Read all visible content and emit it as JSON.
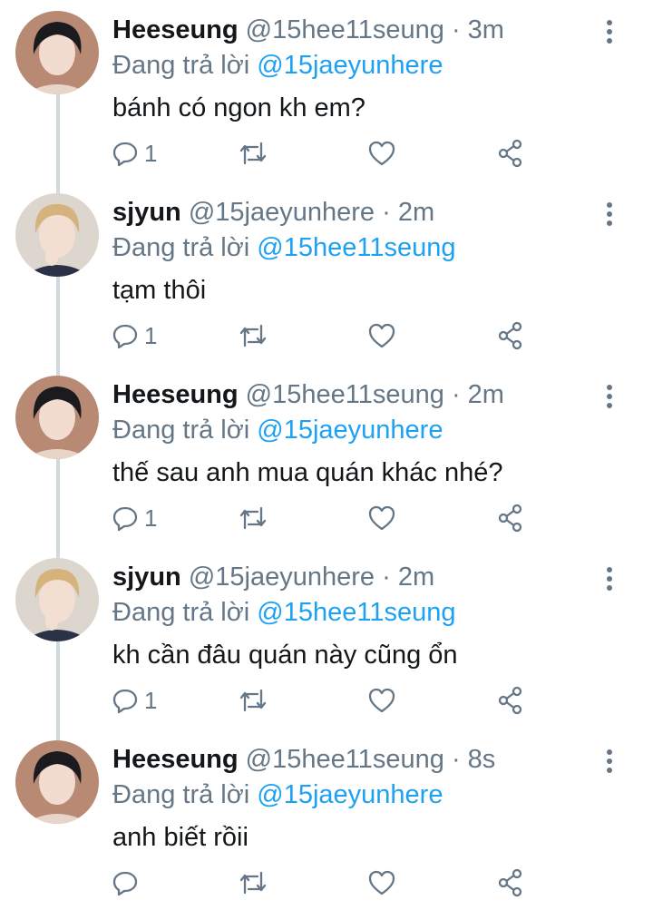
{
  "labels": {
    "replying_prefix": "Đang trả lời",
    "separator": "·"
  },
  "colors": {
    "link": "#1da1f2",
    "muted": "#657786",
    "text": "#14171a",
    "thread_line": "#cfd9de"
  },
  "icons": {
    "reply": "reply-icon",
    "retweet": "retweet-icon",
    "like": "heart-icon",
    "share": "share-icon",
    "more": "more-vertical-icon"
  },
  "tweets": [
    {
      "name": "Heeseung",
      "handle": "@15hee11seung",
      "time": "3m",
      "replying_to": "@15jaeyunhere",
      "text": "bánh có ngon kh em?",
      "reply_count": "1"
    },
    {
      "name": "sjyun",
      "handle": "@15jaeyunhere",
      "time": "2m",
      "replying_to": "@15hee11seung",
      "text": "tạm thôi",
      "reply_count": "1"
    },
    {
      "name": "Heeseung",
      "handle": "@15hee11seung",
      "time": "2m",
      "replying_to": "@15jaeyunhere",
      "text": "thế sau anh mua quán khác nhé?",
      "reply_count": "1"
    },
    {
      "name": "sjyun",
      "handle": "@15jaeyunhere",
      "time": "2m",
      "replying_to": "@15hee11seung",
      "text": "kh cần đâu quán này cũng ổn",
      "reply_count": "1"
    },
    {
      "name": "Heeseung",
      "handle": "@15hee11seung",
      "time": "8s",
      "replying_to": "@15jaeyunhere",
      "text": "anh biết rồii",
      "reply_count": ""
    }
  ]
}
